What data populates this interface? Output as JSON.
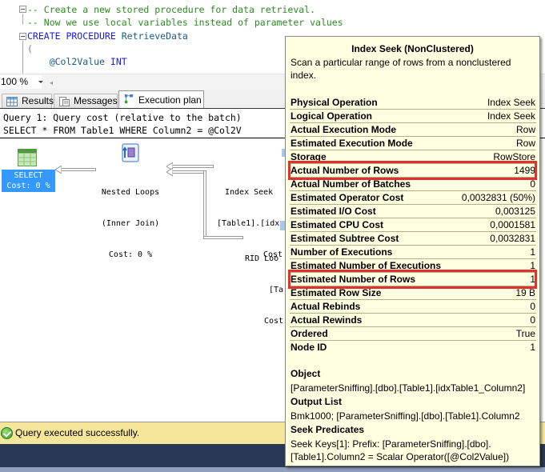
{
  "editor": {
    "lines": [
      {
        "text": "-- Create a new stored procedure for data retrieval.",
        "kind": "comment"
      },
      {
        "text": "-- Now we use local variables instead of parameter values",
        "kind": "comment"
      },
      {
        "kw": "CREATE PROCEDURE",
        "id": "RetrieveData"
      },
      {
        "text": "("
      },
      {
        "var": "@Col2Value",
        "kw": "INT"
      }
    ]
  },
  "zoom": {
    "value": "100 %"
  },
  "tabs": [
    {
      "label": "Results",
      "icon": "grid-icon"
    },
    {
      "label": "Messages",
      "icon": "document-icon"
    },
    {
      "label": "Execution plan",
      "icon": "execution-plan-icon",
      "active": true
    }
  ],
  "plan": {
    "query_header": "Query 1: Query cost (relative to the batch)",
    "query_sql": "SELECT * FROM Table1 WHERE Column2 = @Col2V",
    "nodes": {
      "select": {
        "name": "SELECT",
        "cost": "Cost: 0 %"
      },
      "nested_loops": {
        "name": "Nested Loops",
        "sub": "(Inner Join)",
        "cost": "Cost: 0 %"
      },
      "index_seek": {
        "name": "Index Seek",
        "sub": "[Table1].[idx",
        "cost": "Cost"
      },
      "rid_lookup": {
        "name": "RID Loo",
        "sub": "[Ta",
        "cost": "Cost"
      }
    }
  },
  "status": {
    "text": "Query executed successfully.",
    "icon": "success-check-icon"
  },
  "tooltip": {
    "title": "Index Seek (NonClustered)",
    "description": "Scan a particular range of rows from a nonclustered index.",
    "properties": [
      {
        "key": "Physical Operation",
        "value": "Index Seek"
      },
      {
        "key": "Logical Operation",
        "value": "Index Seek"
      },
      {
        "key": "Actual Execution Mode",
        "value": "Row"
      },
      {
        "key": "Estimated Execution Mode",
        "value": "Row"
      },
      {
        "key": "Storage",
        "value": "RowStore"
      },
      {
        "key": "Actual Number of Rows",
        "value": "1499",
        "highlighted": true
      },
      {
        "key": "Actual Number of Batches",
        "value": "0"
      },
      {
        "key": "Estimated Operator Cost",
        "value": "0,0032831 (50%)"
      },
      {
        "key": "Estimated I/O Cost",
        "value": "0,003125"
      },
      {
        "key": "Estimated CPU Cost",
        "value": "0,0001581"
      },
      {
        "key": "Estimated Subtree Cost",
        "value": "0,0032831"
      },
      {
        "key": "Number of Executions",
        "value": "1"
      },
      {
        "key": "Estimated Number of Executions",
        "value": "1"
      },
      {
        "key": "Estimated Number of Rows",
        "value": "1",
        "highlighted": true
      },
      {
        "key": "Estimated Row Size",
        "value": "19 B"
      },
      {
        "key": "Actual Rebinds",
        "value": "0"
      },
      {
        "key": "Actual Rewinds",
        "value": "0"
      },
      {
        "key": "Ordered",
        "value": "True"
      },
      {
        "key": "Node ID",
        "value": "1"
      }
    ],
    "object": {
      "heading": "Object",
      "value": "[ParameterSniffing].[dbo].[Table1].[idxTable1_Column2]"
    },
    "output_list": {
      "heading": "Output List",
      "value": "Bmk1000; [ParameterSniffing].[dbo].[Table1].Column2"
    },
    "seek_predicates": {
      "heading": "Seek Predicates",
      "lines": [
        "Seek Keys[1]: Prefix: [ParameterSniffing].[dbo].",
        "[Table1].Column2 = Scalar Operator([@Col2Value])"
      ]
    }
  }
}
